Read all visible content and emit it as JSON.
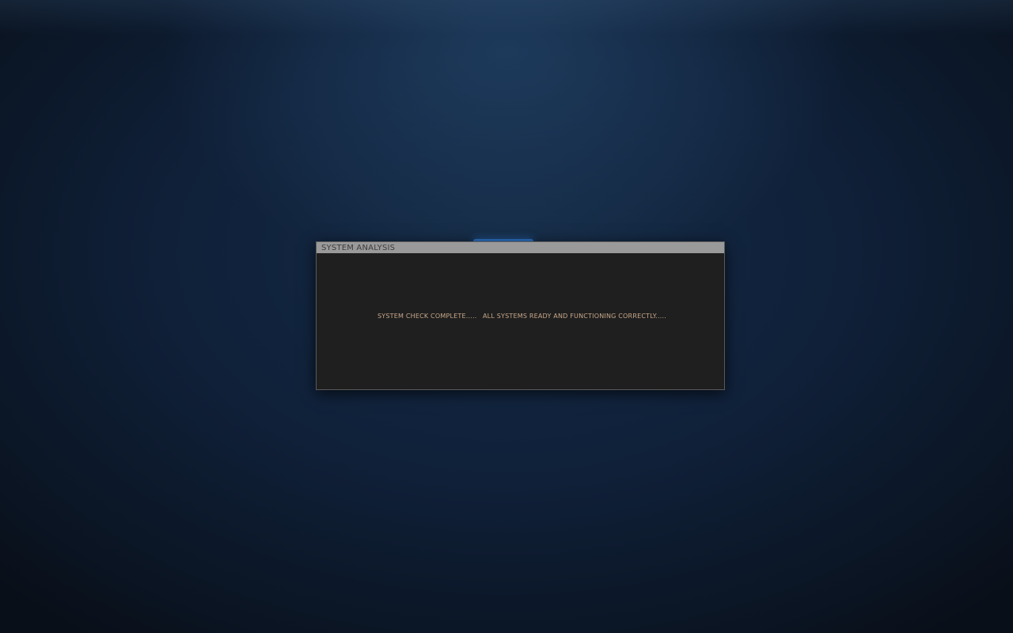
{
  "dialog": {
    "title": "SYSTEM ANALYSIS",
    "messages": [
      "SYSTEM CHECK COMPLETE.....",
      "ALL SYSTEMS READY AND FUNCTIONING CORRECTLY....."
    ]
  },
  "colors": {
    "background": "#10213a",
    "accent": "#2d72c4",
    "dialog_background": "#1f1f1f",
    "titlebar": "#9a9a9a",
    "message_text": "#c9a88a"
  }
}
